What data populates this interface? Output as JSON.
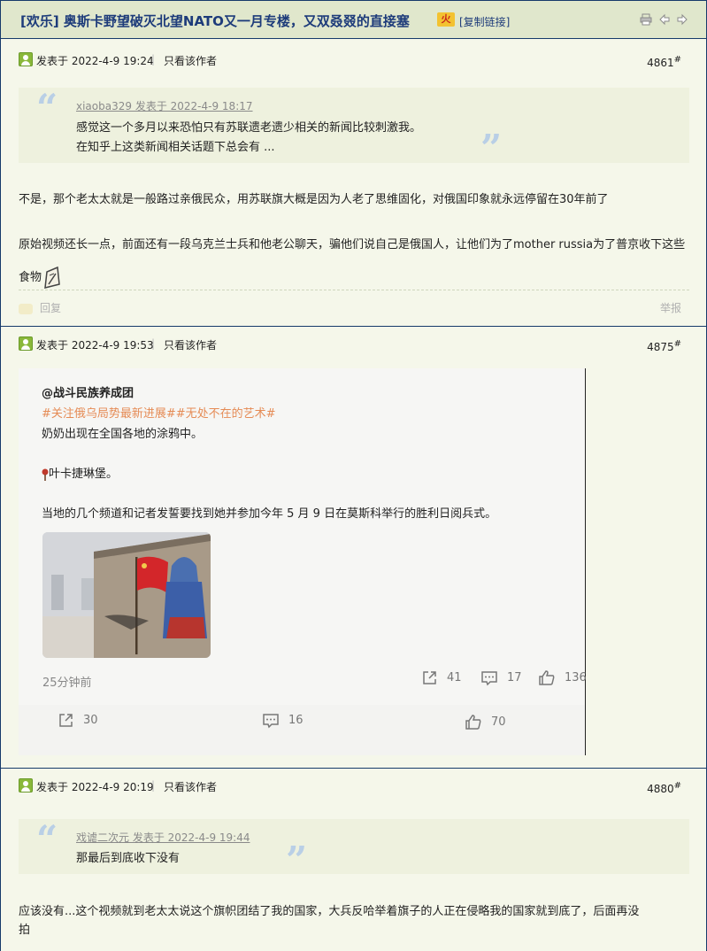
{
  "thread": {
    "title": "[欢乐] 奥斯卡野望破灭北望NATO又一月专楼，又双叒叕的直接塞",
    "badge": "火",
    "copy_link": "[复制链接]"
  },
  "icons": {
    "print": "print-icon",
    "prev": "prev-arrow-icon",
    "next": "next-arrow-icon"
  },
  "posts": [
    {
      "time": "发表于 2022-4-9 19:24",
      "separator": "|",
      "only_author": "只看该作者",
      "floor": "4861",
      "floor_mark": "#",
      "quote": {
        "source": "xiaoba329 发表于 2022-4-9 18:17",
        "lines": [
          "感觉这一个多月以来恐怕只有苏联遗老遗少相关的新闻比较刺激我。",
          "在知乎上这类新闻相关话题下总会有 ..."
        ]
      },
      "paragraphs": [
        "不是，那个老太太就是一般路过亲俄民众，用苏联旗大概是因为人老了思维固化，对俄国印象就永远停留在30年前了",
        "原始视频还长一点，前面还有一段乌克兰士兵和他老公聊天，骗他们说自己是俄国人，让他们为了mother russia为了普京收下这些食物"
      ],
      "reply": "回复",
      "report": "举报"
    },
    {
      "time": "发表于 2022-4-9 19:53",
      "separator": "|",
      "only_author": "只看该作者",
      "floor": "4875",
      "floor_mark": "#",
      "weibo": {
        "author": "@战斗民族养成团",
        "tags": "#关注俄乌局势最新进展##无处不在的艺术#",
        "line1": "奶奶出现在全国各地的涂鸦中。",
        "line2": "叶卡捷琳堡。",
        "line3": "当地的几个频道和记者发誓要找到她并参加今年 5 月 9 日在莫斯科举行的胜利日阅兵式。",
        "time": "25分钟前",
        "inner_share": "41",
        "inner_comment": "17",
        "inner_like": "136",
        "outer_share": "30",
        "outer_comment": "16",
        "outer_like": "70"
      }
    },
    {
      "time": "发表于 2022-4-9 20:19",
      "separator": "|",
      "only_author": "只看该作者",
      "floor": "4880",
      "floor_mark": "#",
      "quote": {
        "source": "戏谑二次元 发表于 2022-4-9 19:44",
        "lines": [
          "那最后到底收下没有"
        ]
      },
      "paragraphs": [
        "应该没有...这个视频就到老太太说这个旗帜团结了我的国家，大兵反哈举着旗子的人正在侵略我的国家就到底了，后面再没",
        "拍"
      ]
    }
  ],
  "colors": {
    "title": "#1d3b7a",
    "background": "#f5f7ea",
    "border": "#163a6a",
    "quote_mark": "#b9cfe6",
    "hashtag": "#e58b55"
  }
}
